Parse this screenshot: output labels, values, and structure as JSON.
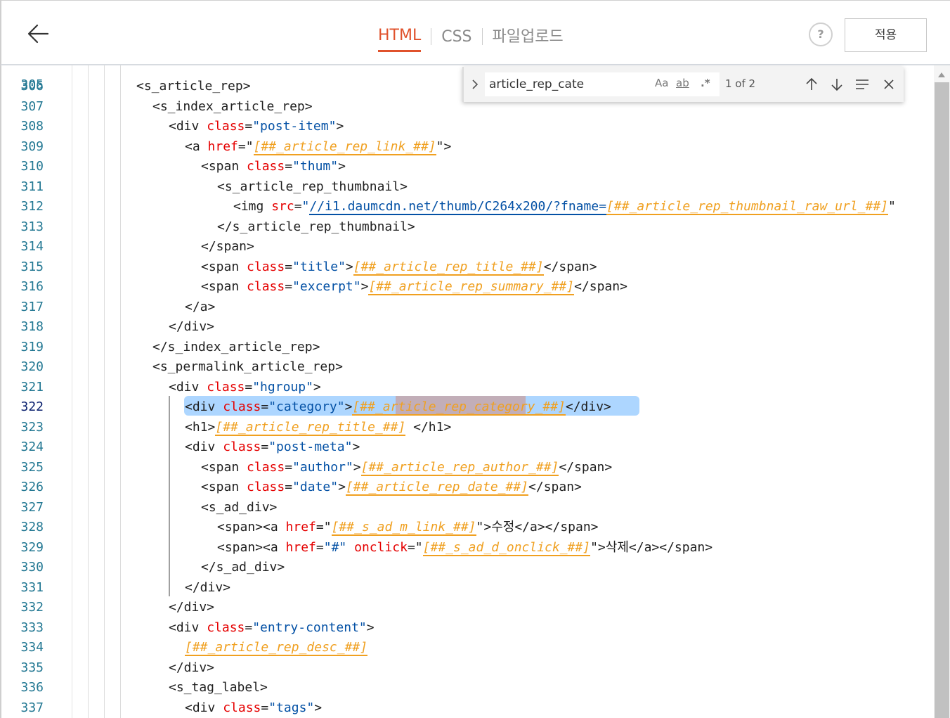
{
  "header": {
    "tabs": [
      "HTML",
      "CSS",
      "파일업로드"
    ],
    "active_tab": "HTML",
    "help_label": "?",
    "apply_label": "적용",
    "accent_color": "#e0522c"
  },
  "find": {
    "query": "article_rep_cate",
    "match_case_label": "Aa",
    "whole_word_label": "ab",
    "regex_label": ".*",
    "count": "1 of 2",
    "icons": [
      "chevron-right-icon",
      "arrow-up-icon",
      "arrow-down-icon",
      "find-in-selection-icon",
      "close-icon"
    ]
  },
  "editor": {
    "partial_top_line": "305",
    "current_line": "322",
    "colors": {
      "tag": "#1f1f1f",
      "attribute": "#e50000",
      "string": "#0451a5",
      "template_var": "#f0a020",
      "line_number": "#237893",
      "selection": "#add6ff"
    },
    "lines": [
      {
        "n": "306",
        "text": "<s_article_rep>"
      },
      {
        "n": "307",
        "text": "<s_index_article_rep>"
      },
      {
        "n": "308",
        "text": "<div class=\"post-item\">"
      },
      {
        "n": "309",
        "text": "<a href=\"[##_article_rep_link_##]\">"
      },
      {
        "n": "310",
        "text": "<span class=\"thum\">"
      },
      {
        "n": "311",
        "text": "<s_article_rep_thumbnail>"
      },
      {
        "n": "312",
        "text": "<img src=\"//i1.daumcdn.net/thumb/C264x200/?fname=[##_article_rep_thumbnail_raw_url_##]\""
      },
      {
        "n": "313",
        "text": "</s_article_rep_thumbnail>"
      },
      {
        "n": "314",
        "text": "</span>"
      },
      {
        "n": "315",
        "text": "<span class=\"title\">[##_article_rep_title_##]</span>"
      },
      {
        "n": "316",
        "text": "<span class=\"excerpt\">[##_article_rep_summary_##]</span>"
      },
      {
        "n": "317",
        "text": "</a>"
      },
      {
        "n": "318",
        "text": "</div>"
      },
      {
        "n": "319",
        "text": "</s_index_article_rep>"
      },
      {
        "n": "320",
        "text": "<s_permalink_article_rep>"
      },
      {
        "n": "321",
        "text": "<div class=\"hgroup\">"
      },
      {
        "n": "322",
        "text": "<div class=\"category\">[##_article_rep_category_##]</div>"
      },
      {
        "n": "323",
        "text": "<h1>[##_article_rep_title_##] </h1>"
      },
      {
        "n": "324",
        "text": "<div class=\"post-meta\">"
      },
      {
        "n": "325",
        "text": "<span class=\"author\">[##_article_rep_author_##]</span>"
      },
      {
        "n": "326",
        "text": "<span class=\"date\">[##_article_rep_date_##]</span>"
      },
      {
        "n": "327",
        "text": "<s_ad_div>"
      },
      {
        "n": "328",
        "text": "<span><a href=\"[##_s_ad_m_link_##]\">수정</a></span>"
      },
      {
        "n": "329",
        "text": "<span><a href=\"#\" onclick=\"[##_s_ad_d_onclick_##]\">삭제</a></span>"
      },
      {
        "n": "330",
        "text": "</s_ad_div>"
      },
      {
        "n": "331",
        "text": "</div>"
      },
      {
        "n": "332",
        "text": "</div>"
      },
      {
        "n": "333",
        "text": "<div class=\"entry-content\">"
      },
      {
        "n": "334",
        "text": "[##_article_rep_desc_##]"
      },
      {
        "n": "335",
        "text": "</div>"
      },
      {
        "n": "336",
        "text": "<s_tag_label>"
      },
      {
        "n": "337",
        "text": "<div class=\"tags\">"
      }
    ]
  }
}
